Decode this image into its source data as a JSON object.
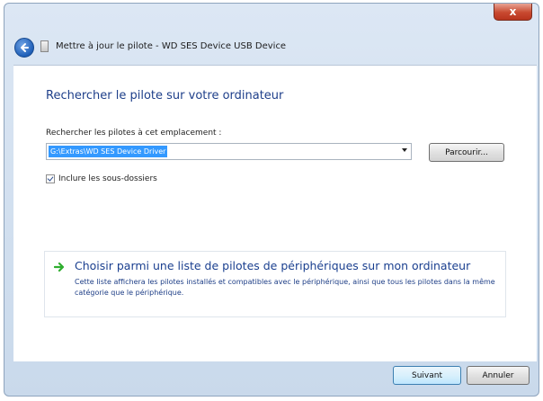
{
  "window": {
    "title": "Mettre à jour le pilote - WD SES Device USB Device",
    "close_label": "x"
  },
  "page": {
    "heading": "Rechercher le pilote sur votre ordinateur",
    "search_label": "Rechercher les pilotes à cet emplacement :",
    "path_value": "G:\\Extras\\WD SES Device Driver",
    "browse_button": "Parcourir...",
    "include_subfolders_label": "Inclure les sous-dossiers",
    "include_subfolders_checked": true
  },
  "option": {
    "icon": "green-arrow-icon",
    "title": "Choisir parmi une liste de pilotes de périphériques sur mon ordinateur",
    "description": "Cette liste affichera les pilotes installés et compatibles avec le périphérique, ainsi que tous les pilotes dans la même catégorie que le périphérique."
  },
  "footer": {
    "next_button": "Suivant",
    "cancel_button": "Annuler"
  },
  "colors": {
    "heading": "#1e3f8a",
    "selection": "#3399ff",
    "arrow": "#2fae2f"
  }
}
